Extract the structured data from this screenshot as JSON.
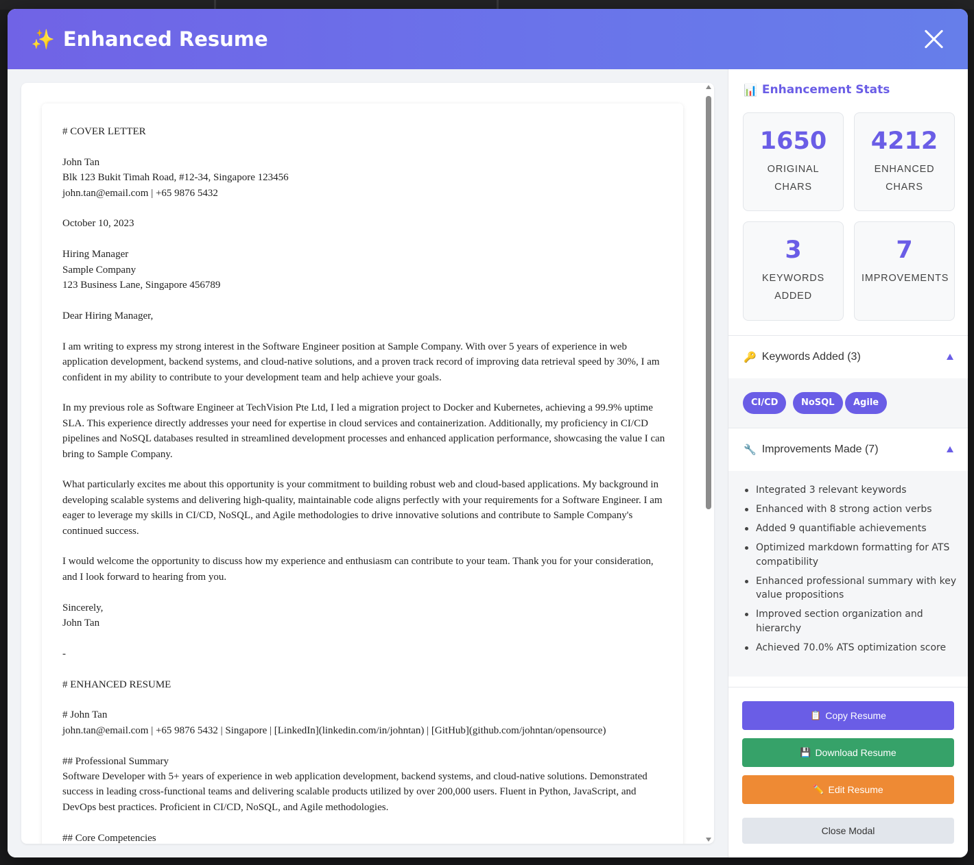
{
  "modal": {
    "title": "Enhanced Resume",
    "title_icon": "✨",
    "close_icon": "close-icon"
  },
  "document": {
    "text": "# COVER LETTER\n\nJohn Tan\nBlk 123 Bukit Timah Road, #12-34, Singapore 123456\njohn.tan@email.com | +65 9876 5432\n\nOctober 10, 2023\n\nHiring Manager\nSample Company\n123 Business Lane, Singapore 456789\n\nDear Hiring Manager,\n\nI am writing to express my strong interest in the Software Engineer position at Sample Company. With over 5 years of experience in web application development, backend systems, and cloud-native solutions, and a proven track record of improving data retrieval speed by 30%, I am confident in my ability to contribute to your development team and help achieve your goals.\n\nIn my previous role as Software Engineer at TechVision Pte Ltd, I led a migration project to Docker and Kubernetes, achieving a 99.9% uptime SLA. This experience directly addresses your need for expertise in cloud services and containerization. Additionally, my proficiency in CI/CD pipelines and NoSQL databases resulted in streamlined development processes and enhanced application performance, showcasing the value I can bring to Sample Company.\n\nWhat particularly excites me about this opportunity is your commitment to building robust web and cloud-based applications. My background in developing scalable systems and delivering high-quality, maintainable code aligns perfectly with your requirements for a Software Engineer. I am eager to leverage my skills in CI/CD, NoSQL, and Agile methodologies to drive innovative solutions and contribute to Sample Company's continued success.\n\nI would welcome the opportunity to discuss how my experience and enthusiasm can contribute to your team. Thank you for your consideration, and I look forward to hearing from you.\n\nSincerely,\nJohn Tan\n\n-\n\n# ENHANCED RESUME\n\n# John Tan\njohn.tan@email.com | +65 9876 5432 | Singapore | [LinkedIn](linkedin.com/in/johntan) | [GitHub](github.com/johntan/opensource)\n\n## Professional Summary\nSoftware Developer with 5+ years of experience in web application development, backend systems, and cloud-native solutions. Demonstrated success in leading cross-functional teams and delivering scalable products utilized by over 200,000 users. Fluent in Python, JavaScript, and DevOps best practices. Proficient in CI/CD, NoSQL, and Agile methodologies.\n\n## Core Competencies"
  },
  "stats": {
    "title": "Enhancement Stats",
    "title_icon": "📊",
    "cards": [
      {
        "value": "1650",
        "label": "ORIGINAL CHARS"
      },
      {
        "value": "4212",
        "label": "ENHANCED CHARS"
      },
      {
        "value": "3",
        "label": "KEYWORDS ADDED"
      },
      {
        "value": "7",
        "label": "IMPROVEMENTS"
      }
    ]
  },
  "keywords": {
    "header": "Keywords Added (3)",
    "icon": "🔑",
    "items": [
      "CI/CD",
      "NoSQL",
      "Agile"
    ]
  },
  "improvements": {
    "header": "Improvements Made (7)",
    "icon": "🔧",
    "items": [
      "Integrated 3 relevant keywords",
      "Enhanced with 8 strong action verbs",
      "Added 9 quantifiable achievements",
      "Optimized markdown formatting for ATS compatibility",
      "Enhanced professional summary with key value propositions",
      "Improved section organization and hierarchy",
      "Achieved 70.0% ATS optimization score"
    ]
  },
  "actions": {
    "copy": {
      "label": "Copy Resume",
      "icon": "📋"
    },
    "download": {
      "label": "Download Resume",
      "icon": "💾"
    },
    "edit": {
      "label": "Edit Resume",
      "icon": "✏️"
    },
    "close": {
      "label": "Close Modal"
    }
  },
  "colors": {
    "accent": "#6a5de6",
    "header_gradient_start": "#7063e6",
    "header_gradient_end": "#667eea",
    "download": "#36a269",
    "edit": "#ee8a34"
  }
}
